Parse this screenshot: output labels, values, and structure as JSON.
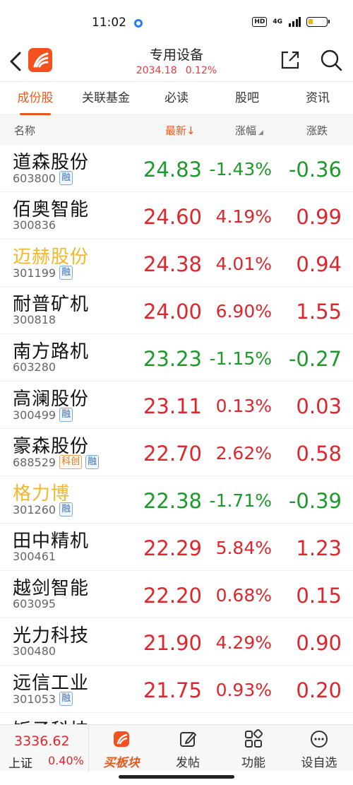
{
  "status_bar": {
    "time": "11:02",
    "hd": "HD",
    "network": "4G",
    "battery_level": 0.25
  },
  "header": {
    "title": "专用设备",
    "index_value": "2034.18",
    "index_change_pct": "0.12%"
  },
  "tabs": [
    {
      "label": "成份股",
      "active": true
    },
    {
      "label": "关联基金",
      "active": false
    },
    {
      "label": "必读",
      "active": false
    },
    {
      "label": "股吧",
      "active": false
    },
    {
      "label": "资讯",
      "active": false
    }
  ],
  "columns": {
    "name": "名称",
    "latest": "最新↓",
    "change_pct": "涨幅",
    "change": "涨跌"
  },
  "stocks": [
    {
      "name": "道森股份",
      "code": "603800",
      "badges": [
        "融"
      ],
      "price": "24.83",
      "pct": "-1.43%",
      "chg": "-0.36",
      "dir": "down",
      "highlight": false
    },
    {
      "name": "佰奥智能",
      "code": "300836",
      "badges": [],
      "price": "24.60",
      "pct": "4.19%",
      "chg": "0.99",
      "dir": "up",
      "highlight": false
    },
    {
      "name": "迈赫股份",
      "code": "301199",
      "badges": [
        "融"
      ],
      "price": "24.38",
      "pct": "4.01%",
      "chg": "0.94",
      "dir": "up",
      "highlight": true
    },
    {
      "name": "耐普矿机",
      "code": "300818",
      "badges": [],
      "price": "24.00",
      "pct": "6.90%",
      "chg": "1.55",
      "dir": "up",
      "highlight": false
    },
    {
      "name": "南方路机",
      "code": "603280",
      "badges": [],
      "price": "23.23",
      "pct": "-1.15%",
      "chg": "-0.27",
      "dir": "down",
      "highlight": false
    },
    {
      "name": "高澜股份",
      "code": "300499",
      "badges": [
        "融"
      ],
      "price": "23.11",
      "pct": "0.13%",
      "chg": "0.03",
      "dir": "up",
      "highlight": false
    },
    {
      "name": "豪森股份",
      "code": "688529",
      "badges": [
        "科创",
        "融"
      ],
      "price": "22.70",
      "pct": "2.62%",
      "chg": "0.58",
      "dir": "up",
      "highlight": false
    },
    {
      "name": "格力博",
      "code": "301260",
      "badges": [
        "融"
      ],
      "price": "22.38",
      "pct": "-1.71%",
      "chg": "-0.39",
      "dir": "down",
      "highlight": true
    },
    {
      "name": "田中精机",
      "code": "300461",
      "badges": [],
      "price": "22.29",
      "pct": "5.84%",
      "chg": "1.23",
      "dir": "up",
      "highlight": false
    },
    {
      "name": "越剑智能",
      "code": "603095",
      "badges": [],
      "price": "22.20",
      "pct": "0.68%",
      "chg": "0.15",
      "dir": "up",
      "highlight": false
    },
    {
      "name": "光力科技",
      "code": "300480",
      "badges": [],
      "price": "21.90",
      "pct": "4.29%",
      "chg": "0.90",
      "dir": "up",
      "highlight": false
    },
    {
      "name": "远信工业",
      "code": "301053",
      "badges": [
        "融"
      ],
      "price": "21.75",
      "pct": "0.93%",
      "chg": "0.20",
      "dir": "up",
      "highlight": false
    }
  ],
  "partial_row_name": "饭子科技",
  "bottom_bar": {
    "index_value": "3336.62",
    "index_name": "上证",
    "index_pct": "0.40%",
    "nav": [
      {
        "label": "买板块",
        "icon": "buy-sector-icon"
      },
      {
        "label": "发帖",
        "icon": "edit-post-icon"
      },
      {
        "label": "功能",
        "icon": "grid-functions-icon"
      },
      {
        "label": "设自选",
        "icon": "more-dots-icon"
      }
    ]
  },
  "colors": {
    "accent": "#e65a1e",
    "up": "#e0262d",
    "down": "#1d9a2b",
    "highlight_name": "#f2b72a"
  }
}
